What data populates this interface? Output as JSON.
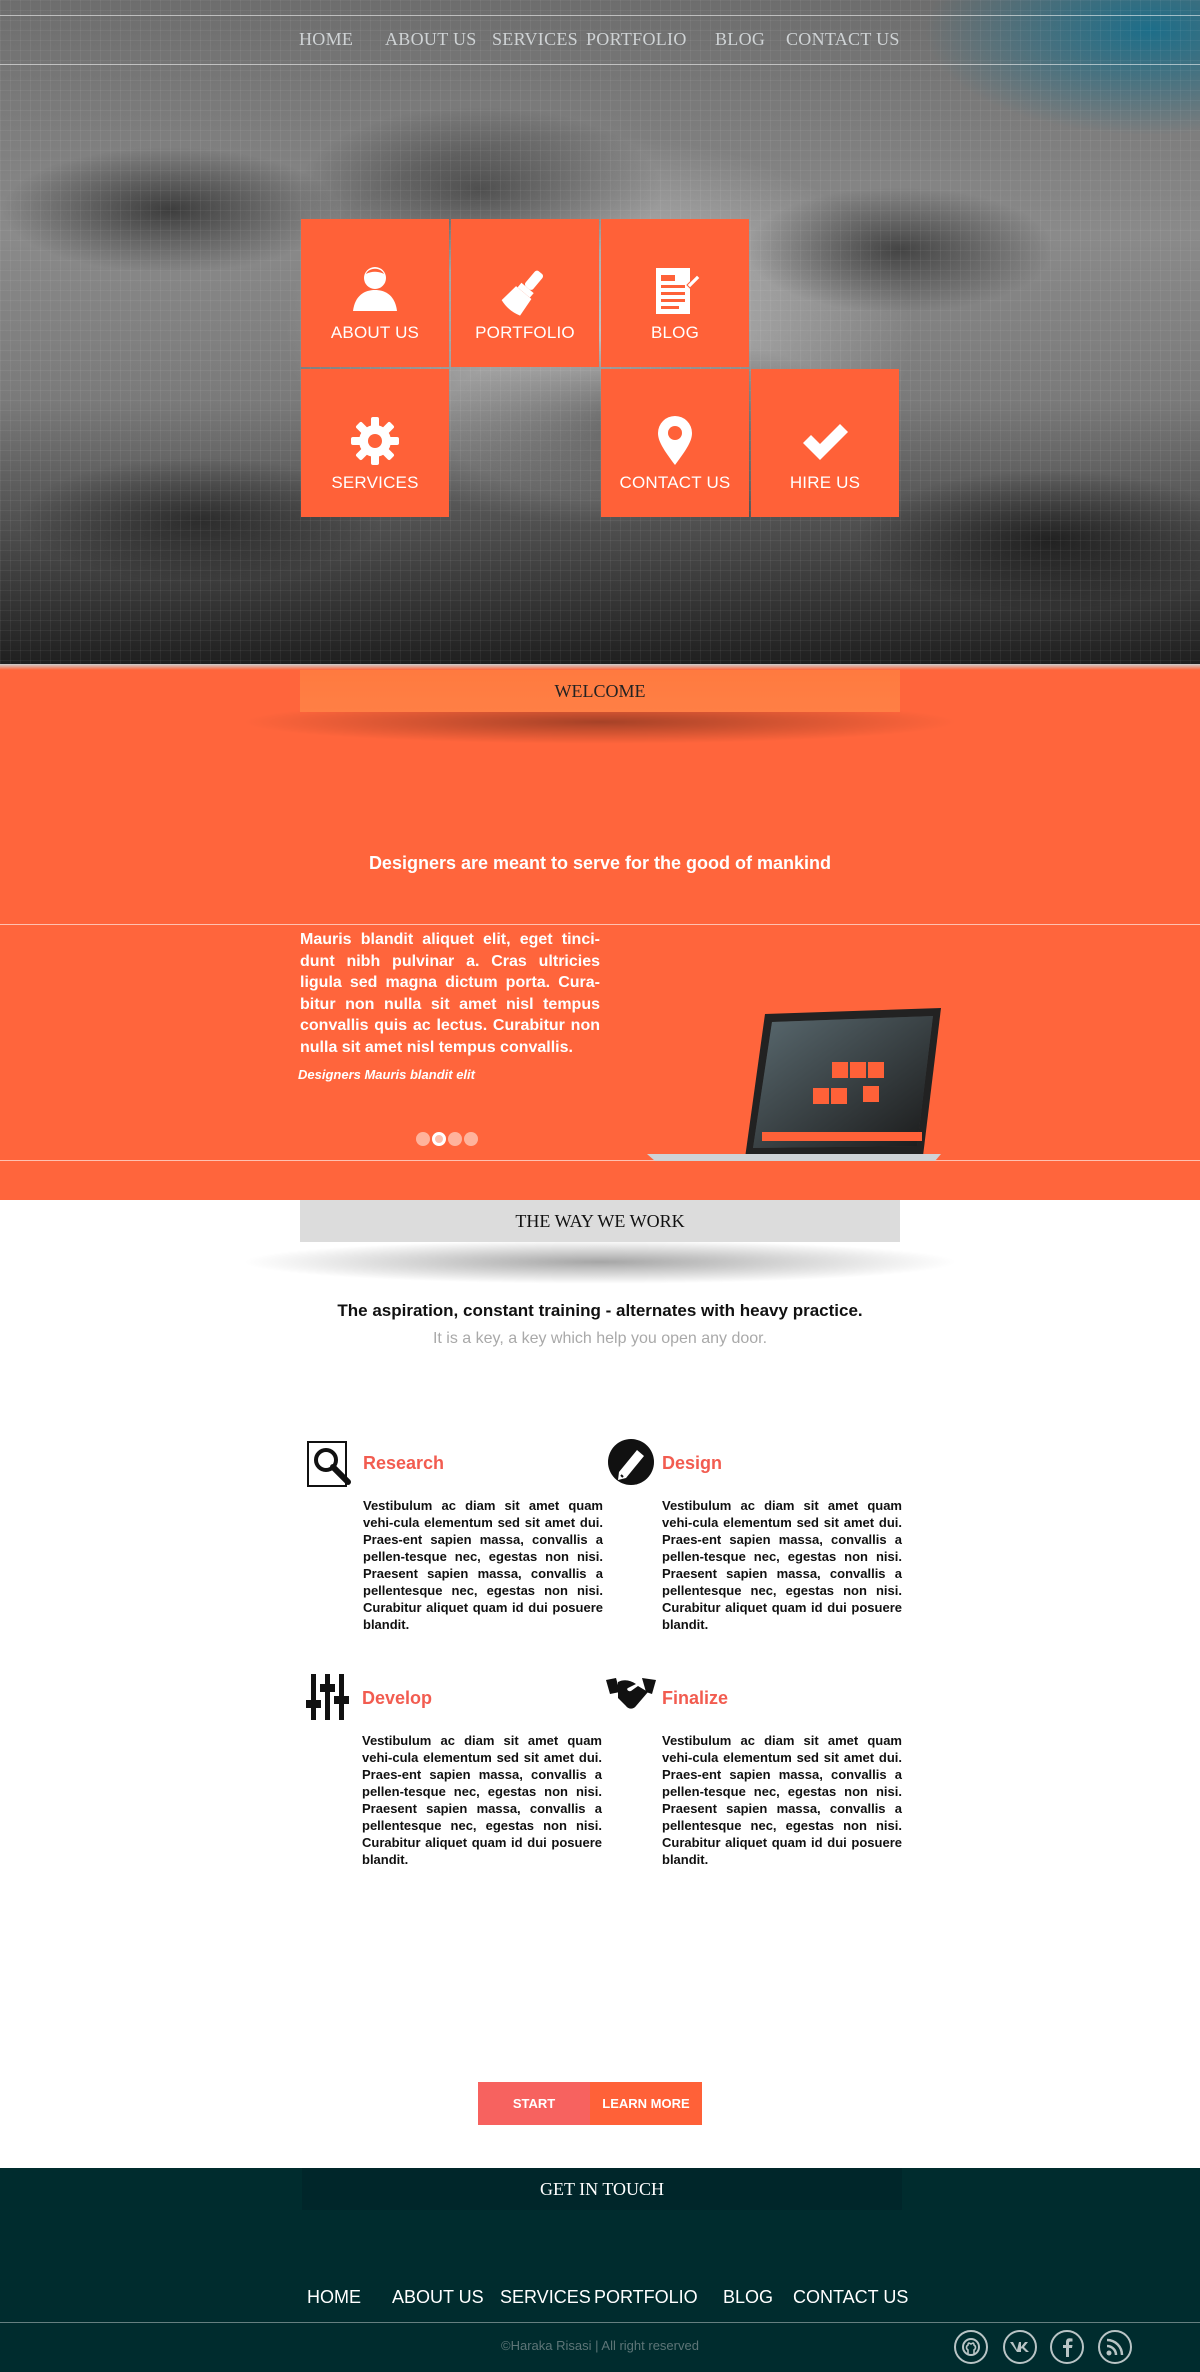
{
  "nav": {
    "items": [
      "HOME",
      "ABOUT US",
      "SERVICES",
      "PORTFOLIO",
      "BLOG",
      "CONTACT US"
    ]
  },
  "tiles": [
    {
      "label": "ABOUT US",
      "icon": "user-icon"
    },
    {
      "label": "PORTFOLIO",
      "icon": "brush-icon"
    },
    {
      "label": "BLOG",
      "icon": "document-icon"
    },
    {
      "label": "SERVICES",
      "icon": "gear-icon"
    },
    {
      "label": "CONTACT US",
      "icon": "map-pin-icon"
    },
    {
      "label": "HIRE US",
      "icon": "checkmark-icon"
    }
  ],
  "welcome": {
    "heading": "WELCOME",
    "tagline": "Designers are meant to serve for the good of mankind",
    "slide_text": "Mauris blandit aliquet elit, eget tinci-dunt nibh pulvinar a. Cras ultricies ligula sed magna dictum porta. Cura-bitur non nulla sit amet nisl tempus convallis quis ac lectus. Curabitur non nulla sit amet nisl tempus convallis.",
    "slide_caption": "Designers Mauris blandit elit",
    "slider_dots": 4,
    "active_dot": 2
  },
  "work": {
    "heading": "THE WAY WE WORK",
    "lead": "The aspiration, constant training - alternates with heavy practice.",
    "sub": "It is a key, a key which help you open any door.",
    "steps": [
      {
        "title": "Research",
        "icon": "magnifier-icon",
        "body": "Vestibulum ac diam sit amet quam vehi-cula elementum sed sit amet dui. Praes-ent sapien massa, convallis a pellen-tesque nec, egestas non nisi. Praesent sapien massa, convallis a pellentesque nec, egestas non nisi. Curabitur aliquet quam id dui posuere blandit."
      },
      {
        "title": "Design",
        "icon": "pen-icon",
        "body": "Vestibulum ac diam sit amet quam vehi-cula elementum sed sit amet dui. Praes-ent sapien massa, convallis a pellen-tesque nec, egestas non nisi. Praesent sapien massa, convallis a pellentesque nec, egestas non nisi. Curabitur aliquet quam id dui posuere blandit."
      },
      {
        "title": "Develop",
        "icon": "sliders-icon",
        "body": "Vestibulum ac diam sit amet quam vehi-cula elementum sed sit amet dui. Praes-ent sapien massa, convallis a pellen-tesque nec, egestas non nisi. Praesent sapien massa, convallis a pellentesque nec, egestas non nisi. Curabitur aliquet quam id dui posuere blandit."
      },
      {
        "title": "Finalize",
        "icon": "handshake-icon",
        "body": "Vestibulum ac diam sit amet quam vehi-cula elementum sed sit amet dui. Praes-ent sapien massa, convallis a pellen-tesque nec, egestas non nisi. Praesent sapien massa, convallis a pellentesque nec, egestas non nisi. Curabitur aliquet quam id dui posuere blandit."
      }
    ]
  },
  "cta": {
    "start": "START",
    "learn_more": "LEARN MORE"
  },
  "footer": {
    "heading": "GET IN TOUCH",
    "nav": [
      "HOME",
      "ABOUT US",
      "SERVICES",
      "PORTFOLIO",
      "BLOG",
      "CONTACT US"
    ],
    "copyright": "©Haraka Risasi | All right reserved",
    "social": [
      "github-icon",
      "vk-icon",
      "facebook-icon",
      "rss-icon"
    ]
  },
  "colors": {
    "accent": "#ff6138",
    "footer_bg": "#002c2e",
    "step_title": "#f25c50"
  }
}
